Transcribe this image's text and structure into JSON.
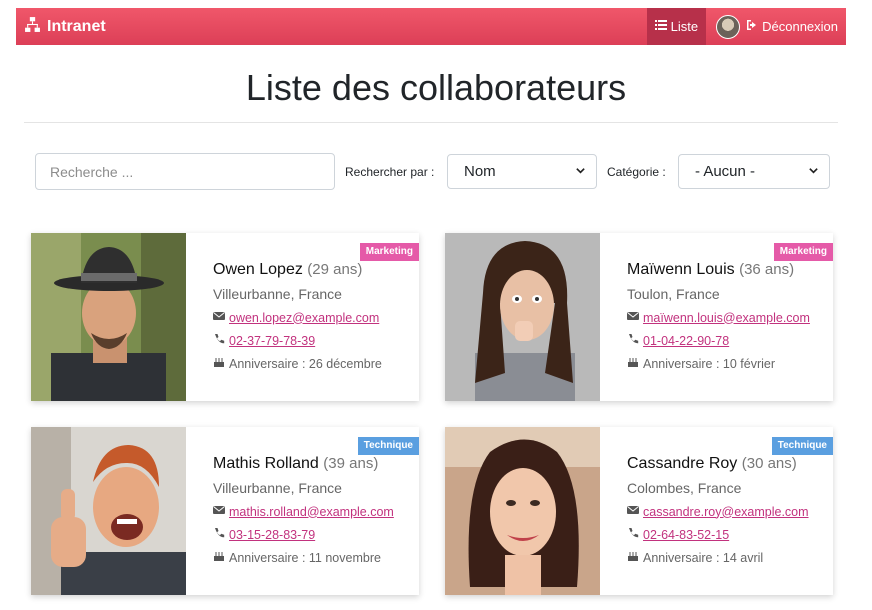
{
  "navbar": {
    "brand": "Intranet",
    "brand_icon": "sitemap-icon",
    "list_link": "Liste",
    "list_icon": "list-icon",
    "logout_link": "Déconnexion",
    "logout_icon": "sign-out-icon"
  },
  "page": {
    "title": "Liste des collaborateurs"
  },
  "filters": {
    "search_placeholder": "Recherche ...",
    "search_by_label": "Rechercher par :",
    "search_by_value": "Nom",
    "category_label": "Catégorie :",
    "category_value": "- Aucun -"
  },
  "cards": [
    {
      "name": "Owen Lopez",
      "age": "(29 ans)",
      "location": "Villeurbanne, France",
      "email": "owen.lopez@example.com",
      "phone": "02-37-79-78-39",
      "birthday": "Anniversaire : 26 décembre",
      "category": "Marketing"
    },
    {
      "name": "Maïwenn Louis",
      "age": "(36 ans)",
      "location": "Toulon, France",
      "email": "maïwenn.louis@example.com",
      "phone": "01-04-22-90-78",
      "birthday": "Anniversaire : 10 février",
      "category": "Marketing"
    },
    {
      "name": "Mathis Rolland",
      "age": "(39 ans)",
      "location": "Villeurbanne, France",
      "email": "mathis.rolland@example.com",
      "phone": "03-15-28-83-79",
      "birthday": "Anniversaire : 11 novembre",
      "category": "Technique"
    },
    {
      "name": "Cassandre Roy",
      "age": "(30 ans)",
      "location": "Colombes, France",
      "email": "cassandre.roy@example.com",
      "phone": "02-64-83-52-15",
      "birthday": "Anniversaire : 14 avril",
      "category": "Technique"
    }
  ],
  "colors": {
    "navbar": "#e14b62",
    "marketing_badge": "#e55aa8",
    "technique_badge": "#5a9fe0",
    "link": "#c2327e"
  }
}
